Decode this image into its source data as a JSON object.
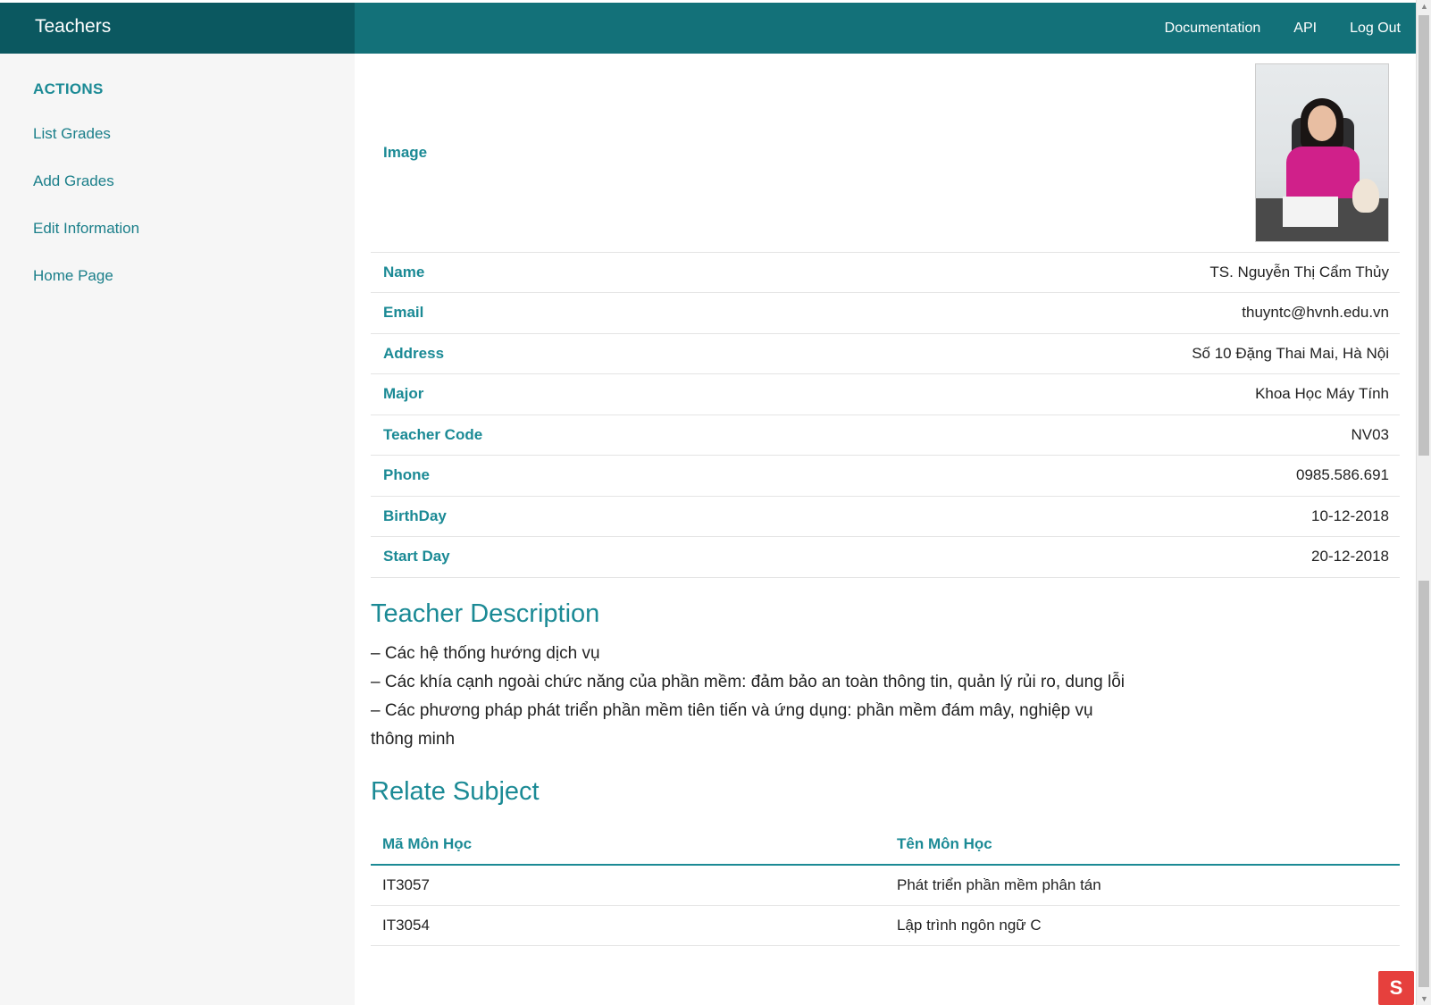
{
  "header": {
    "brand": "Teachers",
    "nav": [
      "Documentation",
      "API",
      "Log Out"
    ]
  },
  "sidebar": {
    "heading": "ACTIONS",
    "items": [
      "List Grades",
      "Add Grades",
      "Edit Information",
      "Home Page"
    ]
  },
  "profile": {
    "image_label": "Image",
    "fields": [
      {
        "label": "Name",
        "value": "TS. Nguyễn Thị Cẩm Thủy"
      },
      {
        "label": "Email",
        "value": "thuyntc@hvnh.edu.vn"
      },
      {
        "label": "Address",
        "value": "Số 10 Đặng Thai Mai, Hà Nội"
      },
      {
        "label": "Major",
        "value": "Khoa Học Máy Tính"
      },
      {
        "label": "Teacher Code",
        "value": "NV03"
      },
      {
        "label": "Phone",
        "value": "0985.586.691"
      },
      {
        "label": "BirthDay",
        "value": "10-12-2018"
      },
      {
        "label": "Start Day",
        "value": "20-12-2018"
      }
    ]
  },
  "description": {
    "title": "Teacher Description",
    "lines": [
      "– Các hệ thống hướng dịch vụ",
      "– Các khía cạnh ngoài chức năng của phần mềm: đảm bảo an toàn thông tin, quản lý rủi ro, dung lỗi",
      "– Các phương pháp phát triển phần mềm tiên tiến và ứng dụng: phần mềm đám mây, nghiệp vụ thông minh"
    ]
  },
  "subjects": {
    "title": "Relate Subject",
    "columns": [
      "Mã Môn Học",
      "Tên Môn Học"
    ],
    "rows": [
      [
        "IT3057",
        "Phát triển phần mềm phân tán"
      ],
      [
        "IT3054",
        "Lập trình ngôn ngữ C"
      ]
    ]
  },
  "colors": {
    "topbar": "#137179",
    "brand_bg": "#0b5860",
    "accent": "#1b8a95",
    "sidebar_bg": "#f6f6f6"
  },
  "icons": {
    "corner_badge": "red-s-badge-icon",
    "scroll_up": "scroll-up-arrow-icon",
    "scroll_down": "scroll-down-arrow-icon"
  }
}
